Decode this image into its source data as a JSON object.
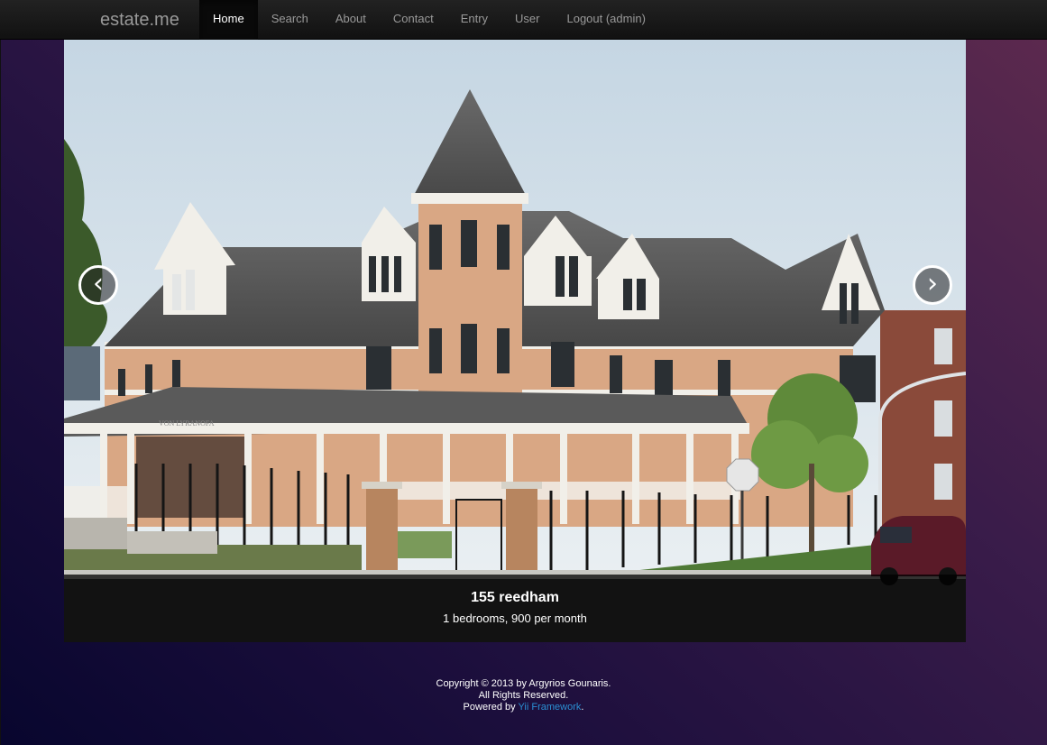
{
  "navbar": {
    "brand": "estate.me",
    "items": [
      {
        "label": "Home",
        "active": true
      },
      {
        "label": "Search",
        "active": false
      },
      {
        "label": "About",
        "active": false
      },
      {
        "label": "Contact",
        "active": false
      },
      {
        "label": "Entry",
        "active": false
      },
      {
        "label": "User",
        "active": false
      },
      {
        "label": "Logout (admin)",
        "active": false
      }
    ]
  },
  "carousel": {
    "prev_icon": "‹",
    "next_icon": "›",
    "caption": {
      "title": "155 reedham",
      "details": "1 bedrooms, 900 per month"
    },
    "photo_sign": "VON LYRANOFA"
  },
  "footer": {
    "copyright": "Copyright © 2013 by Argyrios Gounaris.",
    "rights": "All Rights Reserved.",
    "powered_prefix": "Powered by ",
    "powered_link": "Yii Framework",
    "powered_suffix": "."
  },
  "colors": {
    "navbar": "#1b1b1b",
    "link": "#2a8fd3",
    "background_dark": "#08062e",
    "background_light": "#5e2a4e"
  }
}
